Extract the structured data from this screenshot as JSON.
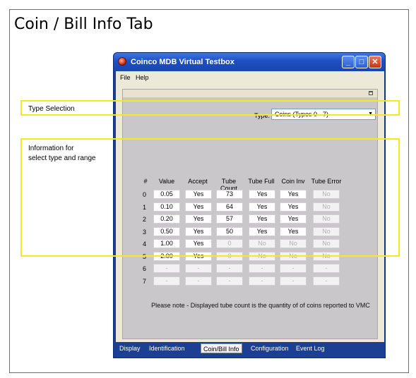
{
  "slide": {
    "title": "Coin / Bill Info Tab",
    "annotations": {
      "type_selection": "Type Selection",
      "info_line1": "Information for",
      "info_line2": "select type and range"
    }
  },
  "window": {
    "title": "Coinco MDB Virtual Testbox",
    "controls": {
      "minimize": "_",
      "maximize": "□",
      "close": "✕"
    }
  },
  "menu": {
    "items": [
      "File",
      "Help"
    ]
  },
  "type_selector": {
    "label": "Type:",
    "value": "Coins (Types 0 - 7)"
  },
  "table": {
    "headers": [
      "#",
      "Value",
      "Accept",
      "Tube Count",
      "Tube Full",
      "Coin Inv",
      "Tube Error"
    ],
    "rows": [
      {
        "idx": "0",
        "cells": [
          "0.05",
          "Yes",
          "73",
          "Yes",
          "Yes",
          "No"
        ],
        "enabled": [
          true,
          true,
          true,
          true,
          true,
          false
        ]
      },
      {
        "idx": "1",
        "cells": [
          "0.10",
          "Yes",
          "64",
          "Yes",
          "Yes",
          "No"
        ],
        "enabled": [
          true,
          true,
          true,
          true,
          true,
          false
        ]
      },
      {
        "idx": "2",
        "cells": [
          "0.20",
          "Yes",
          "57",
          "Yes",
          "Yes",
          "No"
        ],
        "enabled": [
          true,
          true,
          true,
          true,
          true,
          false
        ]
      },
      {
        "idx": "3",
        "cells": [
          "0.50",
          "Yes",
          "50",
          "Yes",
          "Yes",
          "No"
        ],
        "enabled": [
          true,
          true,
          true,
          true,
          true,
          false
        ]
      },
      {
        "idx": "4",
        "cells": [
          "1.00",
          "Yes",
          "0",
          "No",
          "No",
          "No"
        ],
        "enabled": [
          true,
          true,
          false,
          false,
          false,
          false
        ]
      },
      {
        "idx": "5",
        "cells": [
          "2.00",
          "Yes",
          "0",
          "No",
          "No",
          "No"
        ],
        "enabled": [
          true,
          true,
          false,
          false,
          false,
          false
        ]
      },
      {
        "idx": "6",
        "cells": [
          "-",
          "-",
          "-",
          "-",
          "-",
          "-"
        ],
        "enabled": [
          false,
          false,
          false,
          false,
          false,
          false
        ]
      },
      {
        "idx": "7",
        "cells": [
          "-",
          "-",
          "-",
          "-",
          "-",
          "-"
        ],
        "enabled": [
          false,
          false,
          false,
          false,
          false,
          false
        ]
      }
    ]
  },
  "note": "Please note - Displayed tube count is the quantity of of coins reported to VMC",
  "tabs": [
    {
      "label": "Display",
      "active": false
    },
    {
      "label": "Identification",
      "active": false
    },
    {
      "label": "Coin/Bill Info",
      "active": true
    },
    {
      "label": "Configuration",
      "active": false
    },
    {
      "label": "Event Log",
      "active": false
    }
  ],
  "colors": {
    "highlight": "#f5ea22",
    "title_bar": "#1f4fc2",
    "panel": "#c9c7ca"
  }
}
